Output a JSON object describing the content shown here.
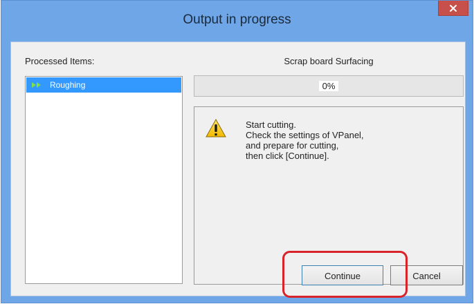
{
  "window": {
    "title": "Output in progress",
    "accent_color": "#6ea6e8",
    "close_icon": "close-icon"
  },
  "processed": {
    "label": "Processed Items:",
    "items": [
      {
        "label": "Roughing",
        "icon": "play-arrows-icon",
        "selected": true
      }
    ]
  },
  "operation": {
    "name": "Scrap board Surfacing",
    "progress_text": "0%",
    "progress_value": 0
  },
  "message": {
    "icon": "warning-icon",
    "lines": [
      "Start cutting.",
      "Check the settings of VPanel,",
      "and prepare for cutting,",
      "then click [Continue]."
    ]
  },
  "buttons": {
    "continue_label": "Continue",
    "cancel_label": "Cancel"
  },
  "annotation": {
    "highlight_color": "#d8232a"
  }
}
